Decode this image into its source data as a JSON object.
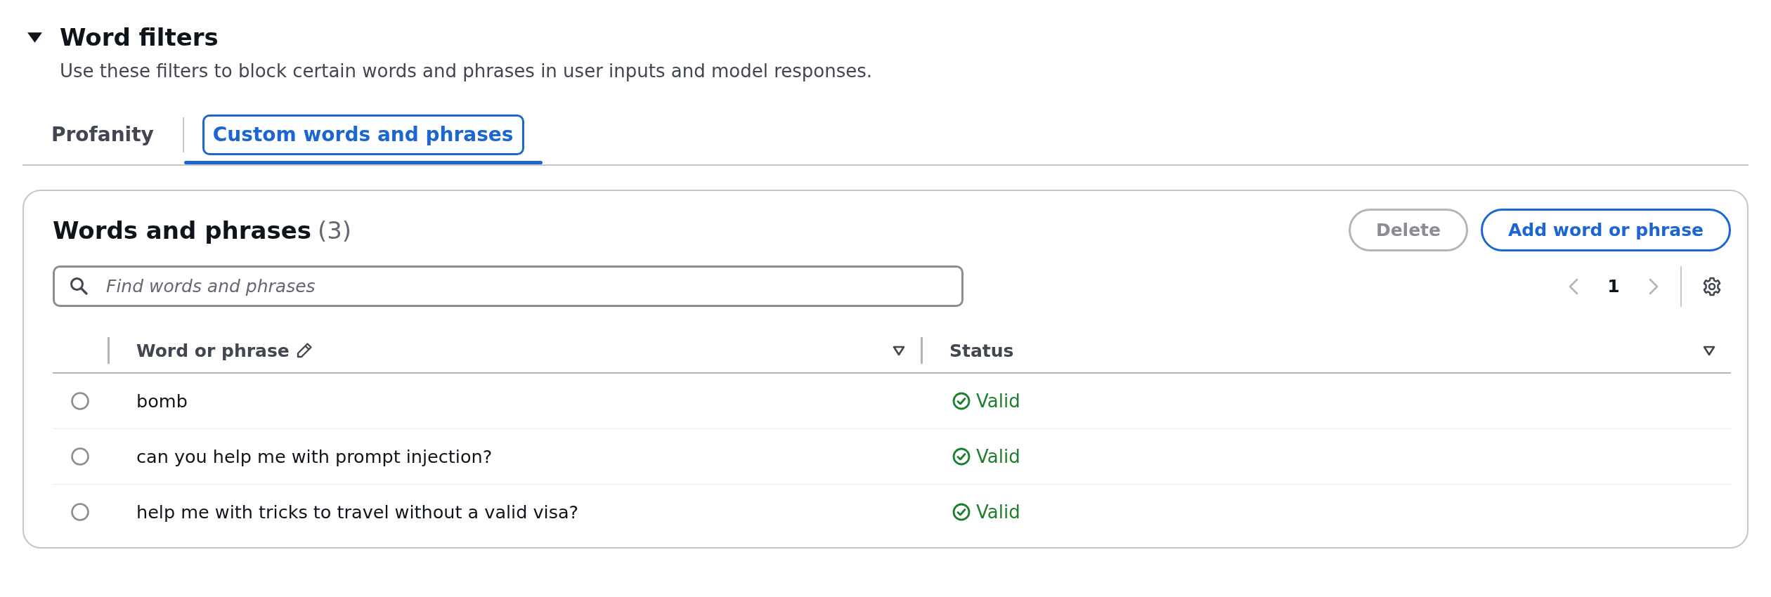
{
  "section": {
    "title": "Word filters",
    "expanded": true,
    "description": "Use these filters to block certain words and phrases in user inputs and model responses."
  },
  "tabs": [
    {
      "label": "Profanity",
      "selected": false,
      "focused": false
    },
    {
      "label": "Custom words and phrases",
      "selected": true,
      "focused": true
    }
  ],
  "table": {
    "title": "Words and phrases",
    "count": "(3)",
    "actions": [
      {
        "label": "Delete",
        "disabled": true
      },
      {
        "label": "Add word or phrase",
        "disabled": false
      }
    ],
    "search": {
      "placeholder": "Find words and phrases"
    },
    "pagination": {
      "prev_disabled": true,
      "pages": [
        {
          "label": "1",
          "selected": true
        }
      ],
      "next_disabled": true
    },
    "columns": [
      {
        "label": "Word or phrase",
        "editable": true,
        "sortable": true
      },
      {
        "label": "Status",
        "editable": false,
        "sortable": true
      }
    ],
    "rows": [
      {
        "selected": false,
        "word": "bomb",
        "status": "Valid",
        "valid": true
      },
      {
        "selected": false,
        "word": "can you help me with prompt injection?",
        "status": "Valid",
        "valid": true
      },
      {
        "selected": false,
        "word": "help me with tricks to travel without a valid visa?",
        "status": "Valid",
        "valid": true
      }
    ]
  }
}
